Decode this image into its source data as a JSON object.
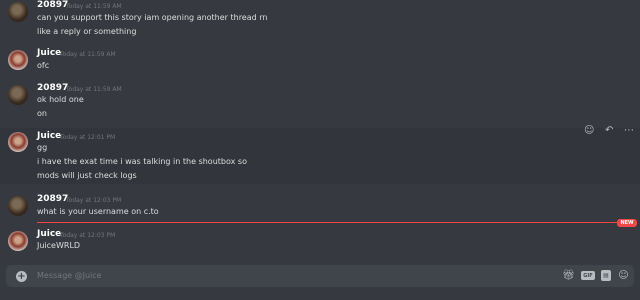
{
  "messages": [
    {
      "author": "20897",
      "time": "Today at 11:59 AM",
      "avatar": "20897",
      "lines": [
        "can you support this story iam opening another thread rn",
        "like a reply or something"
      ]
    },
    {
      "author": "Juice",
      "time": "Today at 11:59 AM",
      "avatar": "juice",
      "lines": [
        "ofc"
      ]
    },
    {
      "author": "20897",
      "time": "Today at 11:59 AM",
      "avatar": "20897",
      "lines": [
        "ok hold one",
        "on"
      ]
    },
    {
      "author": "Juice",
      "time": "Today at 12:01 PM",
      "avatar": "juice",
      "lines": [
        "gg",
        "i have the exat time i was talking in the shoutbox so",
        "mods will just check logs"
      ]
    },
    {
      "author": "20897",
      "time": "Today at 12:03 PM",
      "avatar": "20897",
      "lines": [
        "what is your username on c.to"
      ]
    },
    {
      "author": "Juice",
      "time": "Today at 12:03 PM",
      "avatar": "juice",
      "lines": [
        "JuiceWRLD"
      ]
    }
  ],
  "new_badge": "NEW",
  "composer": {
    "placeholder": "Message @Juice",
    "gif_label": "GIF"
  },
  "hover_actions": [
    "add-reaction-icon",
    "reply-icon",
    "more-options-icon"
  ],
  "colors": {
    "background": "#36393f",
    "composer": "#40444b",
    "new_divider": "#f04747"
  }
}
